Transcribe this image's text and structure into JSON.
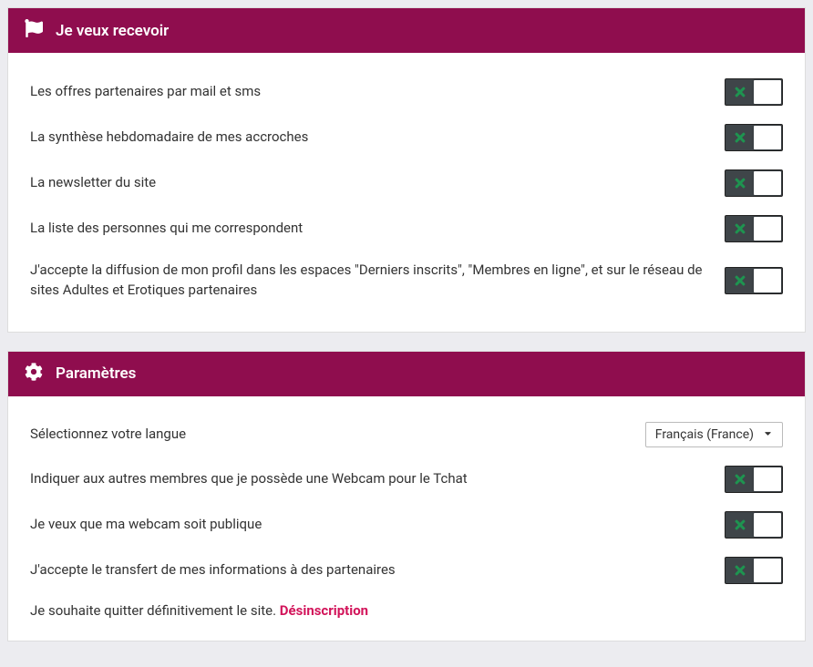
{
  "receive": {
    "title": "Je veux recevoir",
    "items": [
      "Les offres partenaires par mail et sms",
      "La synthèse hebdomadaire de mes accroches",
      "La newsletter du site",
      "La liste des personnes qui me correspondent",
      "J'accepte la diffusion de mon profil dans les espaces \"Derniers inscrits\", \"Membres en ligne\", et sur le réseau de sites Adultes et Erotiques partenaires"
    ]
  },
  "settings": {
    "title": "Paramètres",
    "language_label": "Sélectionnez votre langue",
    "language_value": "Français (France)",
    "items": [
      "Indiquer aux autres membres que je possède une Webcam pour le Tchat",
      "Je veux que ma webcam soit publique",
      "J'accepte le transfert de mes informations à des partenaires"
    ],
    "quit_prefix": "Je souhaite quitter définitivement le site. ",
    "quit_link": "Désinscription"
  }
}
